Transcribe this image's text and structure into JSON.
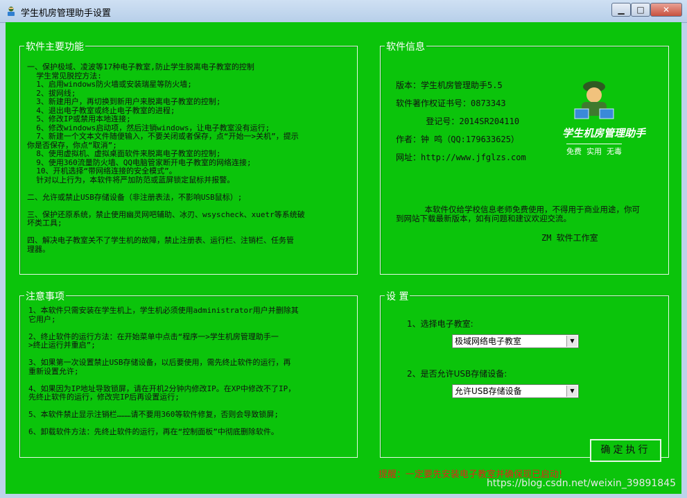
{
  "window": {
    "title": "学生机房管理助手设置",
    "min_label": "▁",
    "max_label": "□",
    "close_label": "✕"
  },
  "features": {
    "title": "软件主要功能",
    "text": "一、保护极域、凌波等17种电子教室,防止学生脱离电子教室的控制\n  学生常见脱控方法:\n  1、启用windows防火墙或安装瑞星等防火墙;\n  2、拔网线;\n  3、新建用户，再切换到新用户来脱离电子教室的控制;\n  4、退出电子教室或终止电子教室的进程;\n  5、修改IP或禁用本地连接;\n  6、修改windows启动项，然后注销windows，让电子教室没有运行;\n  7、新建一个文本文件随便输入，不要关闭或者保存，点“开始一>关机”，提示\n你是否保存，你点“取消”;\n  8、使用虚拟机、虚拟桌面软件来脱离电子教室的控制;\n  9、使用360流量防火墙、QQ电脑管家断开电子教室的网络连接;\n  10、开机选择“带网络连接的安全模式”。\n  针对以上行为，本软件将严加防范或蓝屏锁定鼠标并报警。\n\n二、允许或禁止USB存储设备（非注册表法，不影响USB鼠标）;\n\n三、保护还原系统，禁止使用幽灵网吧辅助、冰刃、wsyscheck、xuetr等系统破\n坏类工具;\n\n四、解决电子教室关不了学生机的故障，禁止注册表、运行栏、注销栏、任务管\n理器。"
  },
  "info": {
    "title": "软件信息",
    "version": "版本：学生机房管理助手5.5",
    "copyright": "软件著作权证书号：0873343",
    "register": "      登记号：2014SR204110",
    "author": "作者：钟 鸣（QQ:179633625）",
    "website": "网址：http://www.jfglzs.com",
    "logo_title": "学生机房管理助手",
    "logo_sub": "免费  实用  无毒",
    "notice": "      本软件仅给学校信息老师免费使用，不得用于商业用途，你可\n到网站下载最新版本，如有问题和建议欢迎交流。",
    "studio": "ZM 软件工作室"
  },
  "notes": {
    "title": "注意事项",
    "text": "1、本软件只需安装在学生机上，学生机必须使用administrator用户并删除其\n它用户;\n\n2、终止软件的运行方法：在开始菜单中点击“程序一>学生机房管理助手一\n>终止运行并重启”;\n\n3、如果第一次设置禁止USB存储设备，以后要使用，需先终止软件的运行，再\n重新设置允许;\n\n4、如果因为IP地址导致锁屏，请在开机2分钟内修改IP。在XP中修改不了IP，\n先终止软件的运行，修改完IP后再设置运行;\n\n5、本软件禁止显示注销栏………请不要用360等软件修复，否则会导致锁屏;\n\n6、卸载软件方法：先终止软件的运行，再在“控制面板”中彻底删除软件。"
  },
  "settings": {
    "title": "设  置",
    "classroom_label": "1、选择电子教室:",
    "classroom_value": "极域网络电子教室",
    "usb_label": "2、是否允许USB存储设备:",
    "usb_value": "允许USB存储设备"
  },
  "footer": {
    "warning": "提醒：一定要先安装电子教室并确保现已启动!",
    "execute": "确定执行",
    "watermark": "https://blog.csdn.net/weixin_39891845"
  },
  "colors": {
    "client_bg": "#0bc40b",
    "warning": "#e0241a"
  }
}
